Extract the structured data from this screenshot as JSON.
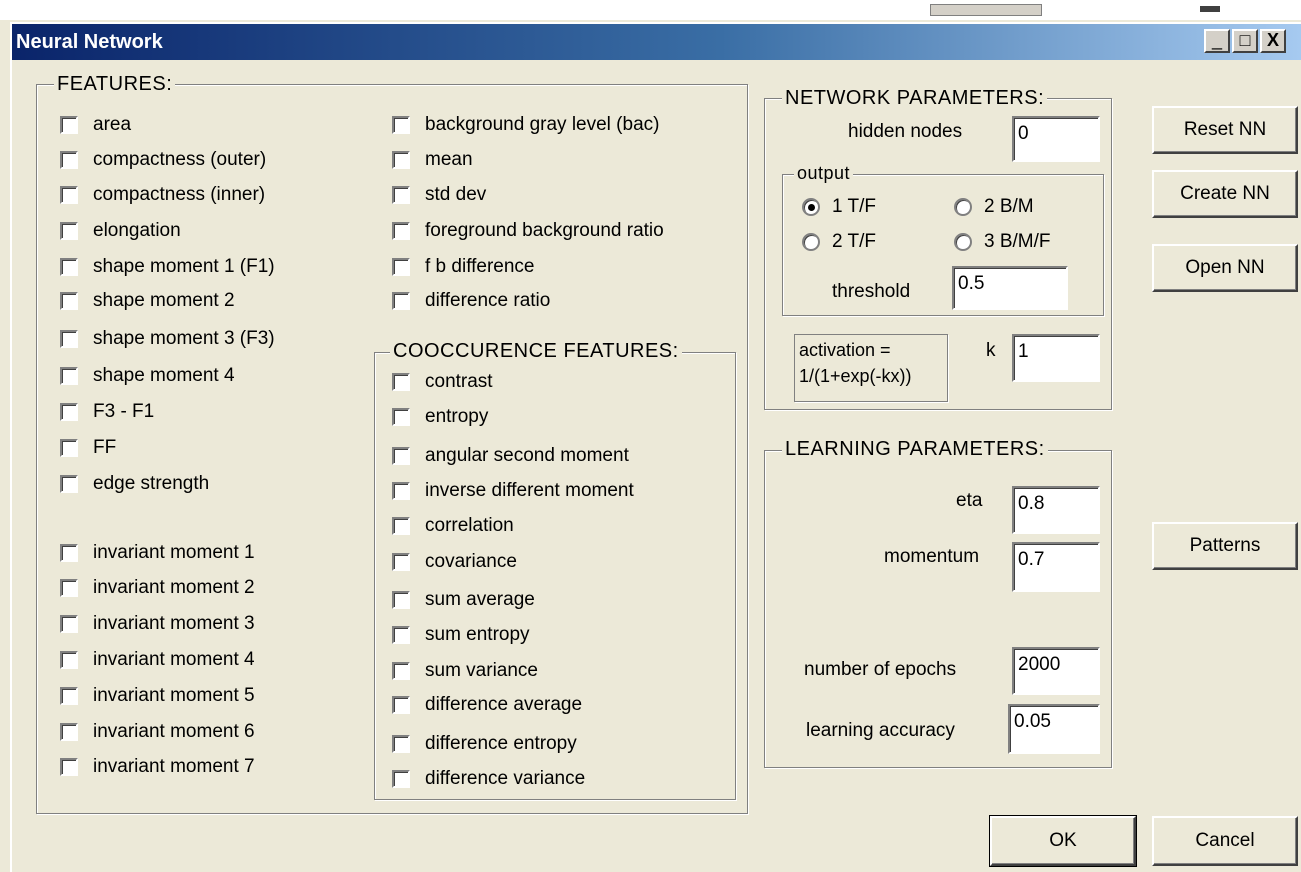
{
  "window": {
    "title": "Neural Network",
    "controls": {
      "minimize": "_",
      "maximize": "□",
      "close": "X"
    }
  },
  "features": {
    "title": "FEATURES:",
    "column1": [
      "area",
      "compactness (outer)",
      "compactness (inner)",
      "elongation",
      "shape moment 1 (F1)",
      "shape moment 2",
      "shape moment 3 (F3)",
      "shape moment 4",
      "F3 - F1",
      "FF",
      "edge strength"
    ],
    "invariant": [
      "invariant moment 1",
      "invariant moment 2",
      "invariant moment 3",
      "invariant moment 4",
      "invariant moment 5",
      "invariant moment 6",
      "invariant moment 7"
    ],
    "column2": [
      "background gray level (bac)",
      "mean",
      "std dev",
      "foreground background ratio",
      "f b difference",
      "difference ratio"
    ]
  },
  "cooccurence": {
    "title": "COOCCURENCE FEATURES:",
    "items": [
      "contrast",
      "entropy",
      "angular second moment",
      "inverse different moment",
      "correlation",
      "covariance",
      "sum average",
      "sum entropy",
      "sum variance",
      "difference average",
      "difference entropy",
      "difference variance"
    ]
  },
  "network": {
    "title": "NETWORK PARAMETERS:",
    "hidden_nodes_label": "hidden nodes",
    "hidden_nodes_value": "0",
    "output_title": "output",
    "output_options": [
      "1 T/F",
      "2 B/M",
      "2 T/F",
      "3 B/M/F"
    ],
    "output_selected": "1 T/F",
    "threshold_label": "threshold",
    "threshold_value": "0.5",
    "activation_line1": "activation =",
    "activation_line2": "1/(1+exp(-kx))",
    "k_label": "k",
    "k_value": "1"
  },
  "learning": {
    "title": "LEARNING PARAMETERS:",
    "eta_label": "eta",
    "eta_value": "0.8",
    "momentum_label": "momentum",
    "momentum_value": "0.7",
    "epochs_label": "number of epochs",
    "epochs_value": "2000",
    "accuracy_label": "learning accuracy",
    "accuracy_value": "0.05"
  },
  "buttons": {
    "reset": "Reset NN",
    "create": "Create NN",
    "open": "Open NN",
    "patterns": "Patterns",
    "ok": "OK",
    "cancel": "Cancel"
  }
}
